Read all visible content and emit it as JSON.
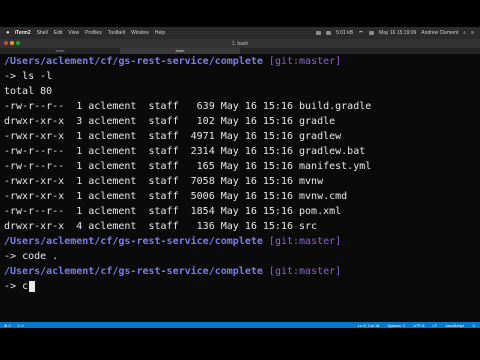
{
  "menubar": {
    "app_name": "iTerm2",
    "items": [
      "Shell",
      "Edit",
      "View",
      "Profiles",
      "Toolbelt",
      "Window",
      "Help"
    ],
    "status": {
      "battery": "5:01 kB",
      "datetime": "May 16  15:19:09",
      "user": "Andrew Clement"
    }
  },
  "window": {
    "title": "1. bash",
    "tabs": [
      "bash",
      "bash"
    ]
  },
  "terminal": {
    "prompt_path": "/Users/aclement/cf/gs-rest-service/complete",
    "prompt_branch": "[git:master]",
    "arrow": "->",
    "cmd1": " ls -l",
    "total": "total 80",
    "files": [
      "-rw-r--r--  1 aclement  staff   639 May 16 15:16 build.gradle",
      "drwxr-xr-x  3 aclement  staff   102 May 16 15:16 gradle",
      "-rwxr-xr-x  1 aclement  staff  4971 May 16 15:16 gradlew",
      "-rw-r--r--  1 aclement  staff  2314 May 16 15:16 gradlew.bat",
      "-rw-r--r--  1 aclement  staff   165 May 16 15:16 manifest.yml",
      "-rwxr-xr-x  1 aclement  staff  7058 May 16 15:16 mvnw",
      "-rwxr-xr-x  1 aclement  staff  5006 May 16 15:16 mvnw.cmd",
      "-rw-r--r--  1 aclement  staff  1854 May 16 15:16 pom.xml",
      "drwxr-xr-x  4 aclement  staff   136 May 16 15:16 src"
    ],
    "cmd2": " code .",
    "cmd3": " c"
  },
  "statusbar": {
    "left": [
      "⊗ 0",
      "⚠ 0"
    ],
    "right": [
      "Ln 8, Col 18",
      "Spaces: 2",
      "UTF-8",
      "LF",
      "JavaScript",
      "☺"
    ]
  }
}
